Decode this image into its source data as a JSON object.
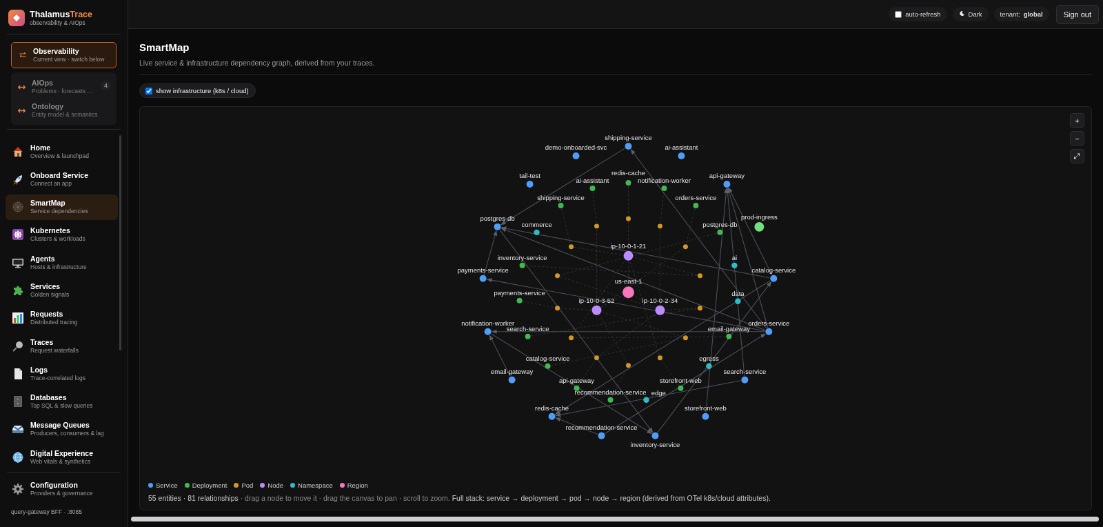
{
  "brand": {
    "name": "Thalamus",
    "accent": "Trace",
    "tagline": "observability & AIOps"
  },
  "switcher": [
    {
      "title": "Observability",
      "subtitle": "Current view · switch below",
      "selected": true
    },
    {
      "title": "AIOps",
      "subtitle": "Problems · forecasts …",
      "badge": "4",
      "selected": false
    },
    {
      "title": "Ontology",
      "subtitle": "Entity model & semantics",
      "selected": false
    }
  ],
  "nav": [
    {
      "title": "Home",
      "subtitle": "Overview & launchpad",
      "selected": false
    },
    {
      "title": "Onboard Service",
      "subtitle": "Connect an app",
      "selected": false
    },
    {
      "title": "SmartMap",
      "subtitle": "Service dependencies",
      "selected": true
    },
    {
      "title": "Kubernetes",
      "subtitle": "Clusters & workloads",
      "selected": false
    },
    {
      "title": "Agents",
      "subtitle": "Hosts & infrastructure",
      "selected": false
    },
    {
      "title": "Services",
      "subtitle": "Golden signals",
      "selected": false
    },
    {
      "title": "Requests",
      "subtitle": "Distributed tracing",
      "selected": false
    },
    {
      "title": "Traces",
      "subtitle": "Request waterfalls",
      "selected": false
    },
    {
      "title": "Logs",
      "subtitle": "Trace-correlated logs",
      "selected": false
    },
    {
      "title": "Databases",
      "subtitle": "Top SQL & slow queries",
      "selected": false
    },
    {
      "title": "Message Queues",
      "subtitle": "Producers, consumers & lag",
      "selected": false
    },
    {
      "title": "Digital Experience",
      "subtitle": "Web vitals & synthetics",
      "selected": false
    }
  ],
  "config": {
    "title": "Configuration",
    "subtitle": "Providers & governance"
  },
  "footer": "query-gateway BFF · :8085",
  "topbar": {
    "auto_refresh": {
      "label": "auto-refresh",
      "checked": false
    },
    "theme": "Dark",
    "tenant": "tenant: **global**",
    "sign_out": "Sign out"
  },
  "page": {
    "title": "SmartMap",
    "subtitle": "Live service & infrastructure dependency graph, derived from your traces."
  },
  "infra_toggle": {
    "label": "show infrastructure (k8s / cloud)",
    "checked": true
  },
  "graph": {
    "zoom_controls": [
      "+",
      "−",
      "⤢"
    ],
    "legend": [
      {
        "kind": "service",
        "label": "Service",
        "color": "#4f9cf9"
      },
      {
        "kind": "deployment",
        "label": "Deployment",
        "color": "#3fb950"
      },
      {
        "kind": "pod",
        "label": "Pod",
        "color": "#d29922"
      },
      {
        "kind": "node",
        "label": "Node",
        "color": "#bc8cff"
      },
      {
        "kind": "namespace",
        "label": "Namespace",
        "color": "#2fbcc9"
      },
      {
        "kind": "region",
        "label": "Region",
        "color": "#f778ba"
      }
    ],
    "nodes": [
      {
        "label": "shipping-service",
        "kind": "service"
      },
      {
        "label": "demo-onboarded-svc",
        "kind": "service"
      },
      {
        "label": "ai-assistant",
        "kind": "service"
      },
      {
        "label": "tail-test",
        "kind": "service"
      },
      {
        "label": "api-gateway",
        "kind": "service"
      },
      {
        "label": "redis-cache",
        "kind": "deployment"
      },
      {
        "label": "ai-assistant",
        "kind": "deployment"
      },
      {
        "label": "notification-worker",
        "kind": "deployment"
      },
      {
        "label": "shipping-service",
        "kind": "deployment"
      },
      {
        "label": "orders-service",
        "kind": "deployment"
      },
      {
        "label": "postgres-db",
        "kind": "service"
      },
      {
        "label": "commerce",
        "kind": "namespace"
      },
      {
        "label": "postgres-db",
        "kind": "deployment"
      },
      {
        "label": "prod-ingress",
        "kind": "ingress"
      },
      {
        "label": "ip-10-0-1-21",
        "kind": "node"
      },
      {
        "label": "inventory-service",
        "kind": "deployment"
      },
      {
        "label": "ai",
        "kind": "namespace"
      },
      {
        "label": "payments-service",
        "kind": "service"
      },
      {
        "label": "catalog-service",
        "kind": "service"
      },
      {
        "label": "us-east-1",
        "kind": "region"
      },
      {
        "label": "payments-service",
        "kind": "deployment"
      },
      {
        "label": "data",
        "kind": "namespace"
      },
      {
        "label": "ip-10-0-3-52",
        "kind": "node"
      },
      {
        "label": "ip-10-0-2-34",
        "kind": "node"
      },
      {
        "label": "notification-worker",
        "kind": "service"
      },
      {
        "label": "orders-service",
        "kind": "service"
      },
      {
        "label": "search-service",
        "kind": "deployment"
      },
      {
        "label": "email-gateway",
        "kind": "deployment"
      },
      {
        "label": "catalog-service",
        "kind": "deployment"
      },
      {
        "label": "egress",
        "kind": "namespace"
      },
      {
        "label": "email-gateway",
        "kind": "service"
      },
      {
        "label": "search-service",
        "kind": "service"
      },
      {
        "label": "api-gateway",
        "kind": "deployment"
      },
      {
        "label": "storefront-web",
        "kind": "deployment"
      },
      {
        "label": "recommendation-service",
        "kind": "deployment"
      },
      {
        "label": "edge",
        "kind": "namespace"
      },
      {
        "label": "redis-cache",
        "kind": "service"
      },
      {
        "label": "storefront-web",
        "kind": "service"
      },
      {
        "label": "recommendation-service",
        "kind": "service"
      },
      {
        "label": "inventory-service",
        "kind": "service"
      },
      {
        "kind": "pod"
      },
      {
        "kind": "pod"
      },
      {
        "kind": "pod"
      },
      {
        "kind": "pod"
      },
      {
        "kind": "pod"
      },
      {
        "kind": "pod"
      },
      {
        "kind": "pod"
      },
      {
        "kind": "pod"
      },
      {
        "kind": "pod"
      },
      {
        "kind": "pod"
      },
      {
        "kind": "pod"
      },
      {
        "kind": "pod"
      },
      {
        "kind": "pod"
      },
      {
        "kind": "pod"
      }
    ],
    "summary": [
      {
        "text": "55 entities · 81 relationships",
        "strong": true
      },
      {
        "text": " · drag a node to move it · drag the canvas to pan · scroll to zoom.",
        "strong": false
      },
      {
        "text": " Full stack: service → deployment → pod → node → region (derived from OTel k8s/cloud attributes).",
        "strong": true
      }
    ]
  }
}
